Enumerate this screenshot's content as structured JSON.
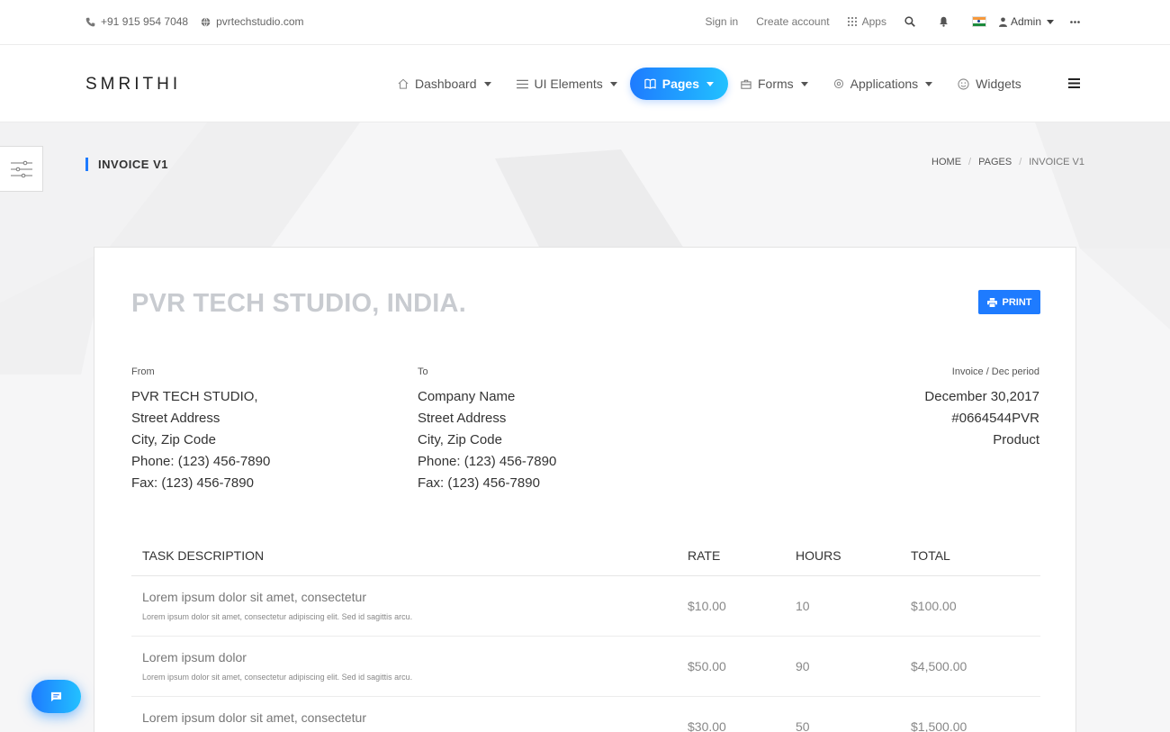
{
  "topbar": {
    "phone": "+91 915 954 7048",
    "website": "pvrtechstudio.com",
    "sign_in": "Sign in",
    "create_account": "Create account",
    "apps": "Apps",
    "admin": "Admin"
  },
  "navbar": {
    "logo": "SMRITHI",
    "items": [
      {
        "label": "Dashboard",
        "icon": "home-icon"
      },
      {
        "label": "UI Elements",
        "icon": "list-icon"
      },
      {
        "label": "Pages",
        "icon": "book-icon",
        "active": true
      },
      {
        "label": "Forms",
        "icon": "briefcase-icon"
      },
      {
        "label": "Applications",
        "icon": "gear-icon"
      },
      {
        "label": "Widgets",
        "icon": "smile-icon"
      }
    ]
  },
  "page": {
    "title": "INVOICE V1",
    "breadcrumb": [
      "HOME",
      "PAGES",
      "INVOICE V1"
    ]
  },
  "invoice": {
    "company": "PVR TECH STUDIO, INDIA.",
    "print_label": "PRINT",
    "from": {
      "label": "From",
      "lines": [
        "PVR TECH STUDIO,",
        "Street Address",
        "City, Zip Code",
        "Phone: (123) 456-7890",
        "Fax: (123) 456-7890"
      ]
    },
    "to": {
      "label": "To",
      "lines": [
        "Company Name",
        "Street Address",
        "City, Zip Code",
        "Phone: (123) 456-7890",
        "Fax: (123) 456-7890"
      ]
    },
    "meta": {
      "label": "Invoice / Dec period",
      "lines": [
        "December 30,2017",
        "#0664544PVR",
        "Product"
      ]
    },
    "table": {
      "headers": [
        "TASK DESCRIPTION",
        "RATE",
        "HOURS",
        "TOTAL"
      ],
      "rows": [
        {
          "desc": "Lorem ipsum dolor sit amet, consectetur",
          "sub": "Lorem ipsum dolor sit amet, consectetur adipiscing elit. Sed id sagittis arcu.",
          "rate": "$10.00",
          "hours": "10",
          "total": "$100.00"
        },
        {
          "desc": "Lorem ipsum dolor",
          "sub": "Lorem ipsum dolor sit amet, consectetur adipiscing elit. Sed id sagittis arcu.",
          "rate": "$50.00",
          "hours": "90",
          "total": "$4,500.00"
        },
        {
          "desc": "Lorem ipsum dolor sit amet, consectetur",
          "sub": "",
          "rate": "$30.00",
          "hours": "50",
          "total": "$1,500.00"
        }
      ]
    }
  },
  "colors": {
    "accent": "#1e7bff",
    "accent_light": "#22c1ff",
    "company_text": "#c8cbd0"
  }
}
